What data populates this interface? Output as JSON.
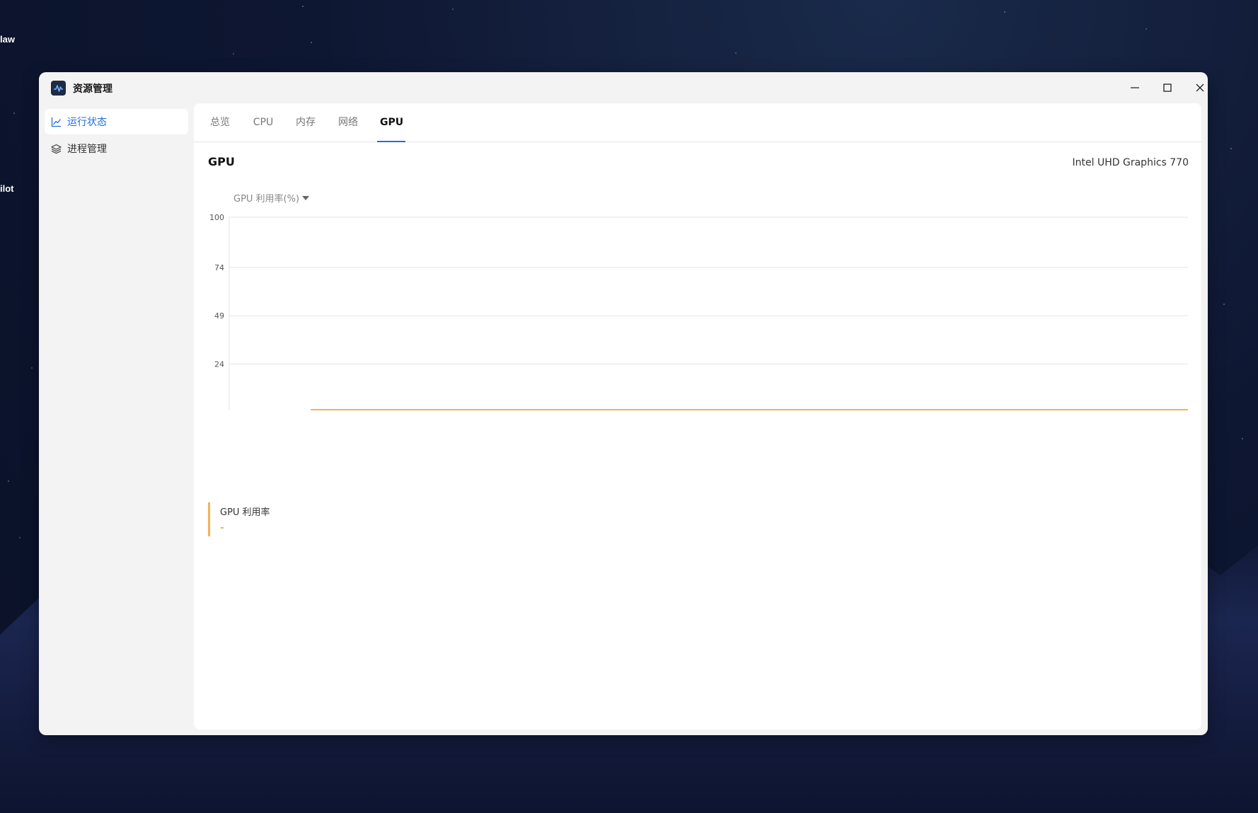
{
  "desktop": {
    "labels": [
      "law",
      "ilot"
    ]
  },
  "window": {
    "title": "资源管理",
    "controls": {
      "minimize": "minimize-icon",
      "maximize": "maximize-icon",
      "close": "close-icon"
    }
  },
  "sidebar": {
    "items": [
      {
        "label": "运行状态",
        "icon": "line-chart-icon",
        "active": true
      },
      {
        "label": "进程管理",
        "icon": "layers-icon",
        "active": false
      }
    ]
  },
  "tabs": [
    {
      "label": "总览",
      "active": false
    },
    {
      "label": "CPU",
      "active": false
    },
    {
      "label": "内存",
      "active": false
    },
    {
      "label": "网络",
      "active": false
    },
    {
      "label": "GPU",
      "active": true
    }
  ],
  "gpu": {
    "section_title": "GPU",
    "device_name": "Intel UHD Graphics 770",
    "metric_selector": "GPU 利用率(%)",
    "legend": {
      "name": "GPU 利用率",
      "value": "-"
    }
  },
  "colors": {
    "accent": "#1f6fe0",
    "series": "#f7b155",
    "grid": "#e6e6e6"
  },
  "chart_data": {
    "type": "line",
    "ylim": [
      0,
      100
    ],
    "yticks": [
      24,
      49,
      74,
      100
    ],
    "series": [
      {
        "values": [
          0,
          0,
          0,
          0,
          0,
          0,
          0,
          0,
          0,
          0,
          0,
          0,
          0
        ],
        "start_fraction": 0.085
      }
    ]
  }
}
